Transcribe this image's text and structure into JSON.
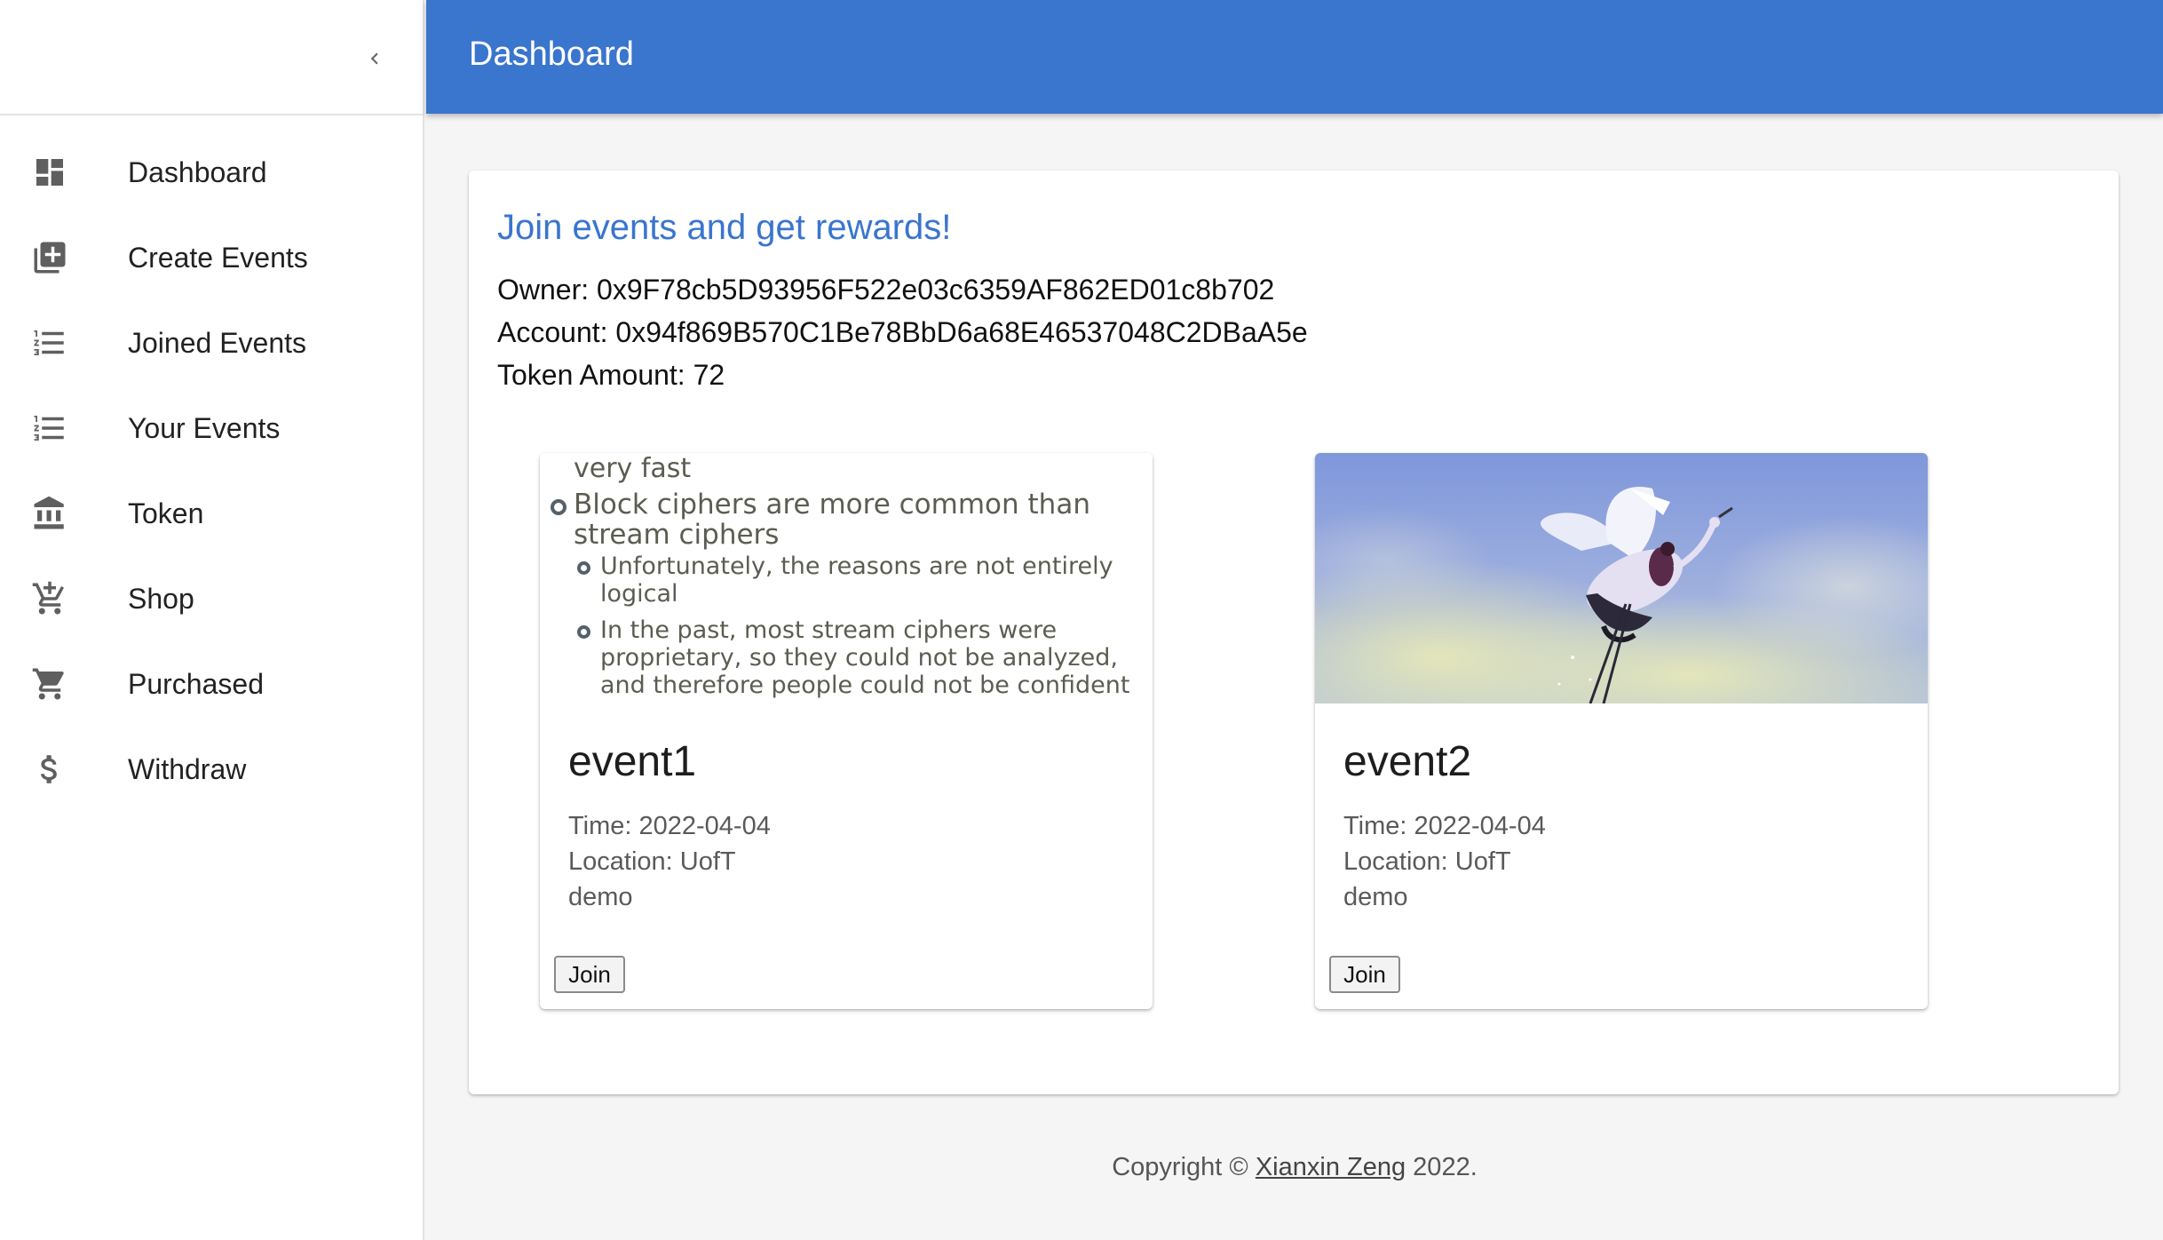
{
  "sidebar": {
    "items": [
      {
        "label": "Dashboard",
        "icon": "dashboard-icon"
      },
      {
        "label": "Create Events",
        "icon": "library-add-icon"
      },
      {
        "label": "Joined Events",
        "icon": "format-list-numbered-icon"
      },
      {
        "label": "Your Events",
        "icon": "format-list-numbered-icon"
      },
      {
        "label": "Token",
        "icon": "bank-icon"
      },
      {
        "label": "Shop",
        "icon": "add-shopping-cart-icon"
      },
      {
        "label": "Purchased",
        "icon": "shopping-cart-icon"
      },
      {
        "label": "Withdraw",
        "icon": "dollar-icon"
      }
    ]
  },
  "appbar": {
    "title": "Dashboard",
    "color": "#3a75ce"
  },
  "main": {
    "heading": "Join events and get rewards!",
    "owner_line": "Owner: 0x9F78cb5D93956F522e03c6359AF862ED01c8b702",
    "account_line": "Account: 0x94f869B570C1Be78BbD6a68E46537048C2DBaA5e",
    "token_line": "Token Amount: 72",
    "events": [
      {
        "name": "event1",
        "time": "Time: 2022-04-04",
        "location": "Location: UofT",
        "description": "demo",
        "join_label": "Join",
        "image": {
          "type": "slide",
          "lines": [
            "very fast",
            "Block ciphers are more common than",
            "stream ciphers",
            "Unfortunately, the reasons are not entirely",
            "logical",
            "In the past, most stream ciphers were",
            "proprietary, so they could not be analyzed,",
            "and therefore people could not be confident"
          ]
        }
      },
      {
        "name": "event2",
        "time": "Time: 2022-04-04",
        "location": "Location: UofT",
        "description": "demo",
        "join_label": "Join",
        "image": {
          "type": "illustration",
          "subject": "crane-flying-in-sky"
        }
      }
    ]
  },
  "footer": {
    "prefix": "Copyright © ",
    "author": "Xianxin Zeng",
    "suffix": " 2022."
  }
}
